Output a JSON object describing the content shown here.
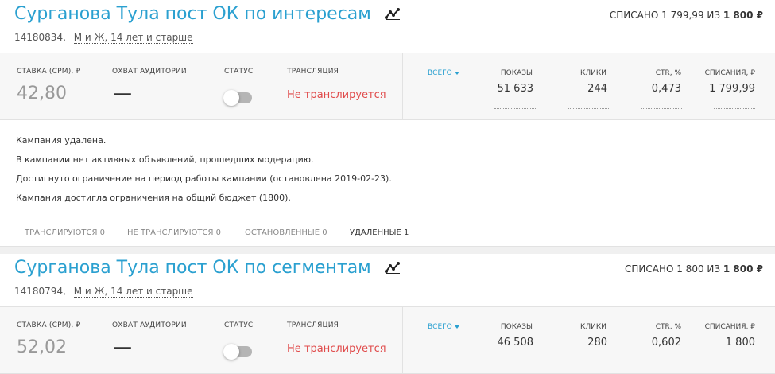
{
  "campaigns": [
    {
      "title": "Сурганова Тула пост ОК по интересам",
      "id": "14180834,",
      "audience": "М и Ж, 14 лет и старше",
      "spent_prefix": "СПИСАНО 1 799,99 ИЗ ",
      "spent_limit": "1 800 ₽",
      "rate_label": "СТАВКА (CPM), ₽",
      "rate_value": "42,80",
      "reach_label": "ОХВАТ АУДИТОРИИ",
      "reach_value": "—",
      "status_label": "СТАТУС",
      "status_on": false,
      "broadcast_label": "ТРАНСЛЯЦИЯ",
      "broadcast_value": "Не транслируется",
      "period": "ВСЕГО",
      "metrics": [
        {
          "label": "ПОКАЗЫ",
          "value": "51 633"
        },
        {
          "label": "КЛИКИ",
          "value": "244"
        },
        {
          "label": "CTR, %",
          "value": "0,473"
        },
        {
          "label": "СПИСАНИЯ, ₽",
          "value": "1 799,99"
        }
      ],
      "messages": [
        "Кампания удалена.",
        "В кампании нет активных объявлений, прошедших модерацию.",
        "Достигнуто ограничение на период работы кампании (остановлена 2019-02-23).",
        "Кампания достигла ограничения на общий бюджет (1800)."
      ],
      "tabs": [
        {
          "label": "ТРАНСЛИРУЮТСЯ 0",
          "active": false
        },
        {
          "label": "НЕ ТРАНСЛИРУЮТСЯ 0",
          "active": false
        },
        {
          "label": "ОСТАНОВЛЕННЫЕ 0",
          "active": false
        },
        {
          "label": "УДАЛЁННЫЕ 1",
          "active": true
        }
      ]
    },
    {
      "title": "Сурганова Тула пост ОК по сегментам",
      "id": "14180794,",
      "audience": "М и Ж, 14 лет и старше",
      "spent_prefix": "СПИСАНО 1 800 ИЗ ",
      "spent_limit": "1 800 ₽",
      "rate_label": "СТАВКА (CPM), ₽",
      "rate_value": "52,02",
      "reach_label": "ОХВАТ АУДИТОРИИ",
      "reach_value": "—",
      "status_label": "СТАТУС",
      "status_on": false,
      "broadcast_label": "ТРАНСЛЯЦИЯ",
      "broadcast_value": "Не транслируется",
      "period": "ВСЕГО",
      "metrics": [
        {
          "label": "ПОКАЗЫ",
          "value": "46 508"
        },
        {
          "label": "КЛИКИ",
          "value": "280"
        },
        {
          "label": "CTR, %",
          "value": "0,602"
        },
        {
          "label": "СПИСАНИЯ, ₽",
          "value": "1 800"
        }
      ]
    }
  ],
  "colors": {
    "title": "#2aa0d0",
    "not_broadcasting": "#e04a4a",
    "accent": "#2aa0d0"
  },
  "icons": {
    "trend": "trend-chart-icon",
    "dropdown": "caret-down-icon"
  }
}
